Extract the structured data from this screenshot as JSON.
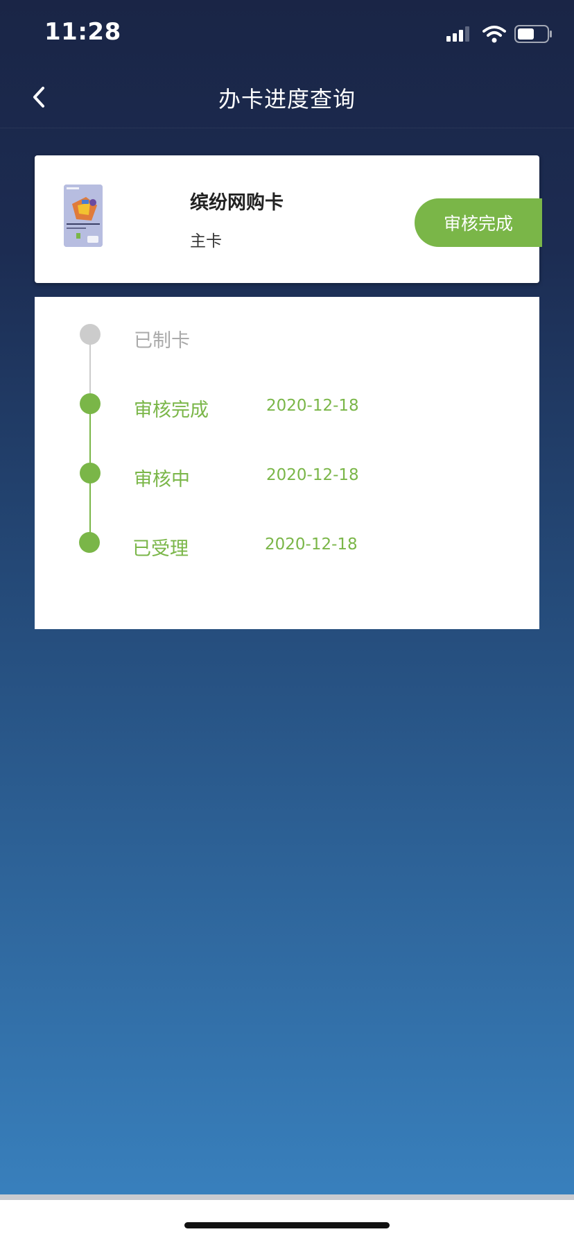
{
  "status_bar": {
    "time": "11:28",
    "icons": [
      "cellular-signal-icon",
      "wifi-icon",
      "battery-icon"
    ]
  },
  "nav": {
    "title": "办卡进度查询",
    "back_icon": "chevron-left-icon"
  },
  "card": {
    "name": "缤纷网购卡",
    "type": "主卡",
    "status": "审核完成",
    "thumbnail_icon": "credit-card-image"
  },
  "timeline": {
    "steps": [
      {
        "label": "已制卡",
        "date": "",
        "state": "pending"
      },
      {
        "label": "审核完成",
        "date": "2020-12-18",
        "state": "done"
      },
      {
        "label": "审核中",
        "date": "2020-12-18",
        "state": "done"
      },
      {
        "label": "已受理",
        "date": "2020-12-18",
        "state": "done"
      }
    ]
  },
  "colors": {
    "accent_green": "#7ab648",
    "pending_gray": "#cccccc",
    "pending_text": "#aaaaaa",
    "header_navy": "#1a2546",
    "gradient_bottom": "#3a84c2"
  }
}
